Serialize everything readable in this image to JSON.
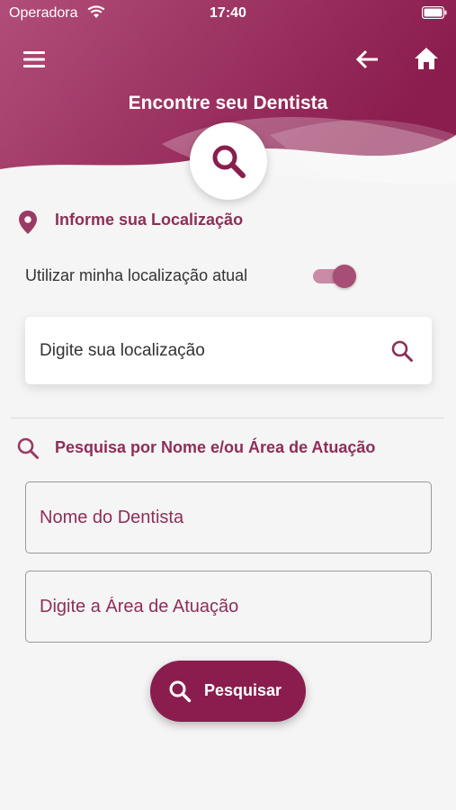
{
  "status_bar": {
    "carrier": "Operadora",
    "time": "17:40",
    "wifi_icon": "wifi-icon",
    "battery_icon": "battery-icon"
  },
  "header": {
    "title": "Encontre seu Dentista",
    "menu_icon": "menu-icon",
    "back_icon": "arrow-left-icon",
    "home_icon": "home-icon",
    "center_icon": "search-icon",
    "gradient_start": "#b5507a",
    "gradient_end": "#8a1d4e"
  },
  "location_section": {
    "title": "Informe sua Localização",
    "icon": "location-pin-icon",
    "toggle_label": "Utilizar minha localização atual",
    "toggle_on": true,
    "input_placeholder": "Digite sua localização",
    "input_value": ""
  },
  "name_section": {
    "title": "Pesquisa por Nome e/ou Área de Atuação",
    "icon": "search-icon",
    "name_placeholder": "Nome do Dentista",
    "area_placeholder": "Digite a Área de Atuação"
  },
  "actions": {
    "search_label": "Pesquisar"
  },
  "colors": {
    "accent": "#8e2e58",
    "button": "#8a1d4e",
    "background": "#f5f5f5"
  }
}
